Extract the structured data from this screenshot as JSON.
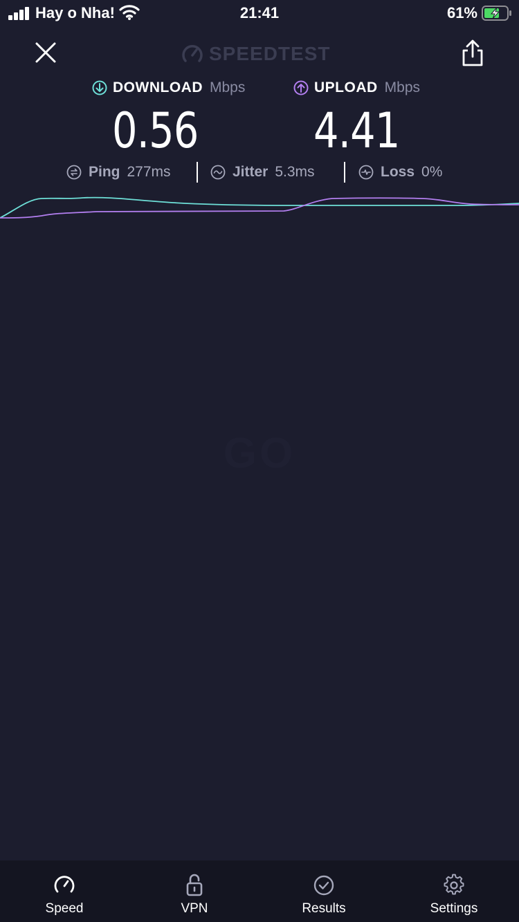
{
  "status_bar": {
    "carrier": "Hay o Nha!",
    "time": "21:41",
    "battery": "61%"
  },
  "header": {
    "brand": "SPEEDTEST"
  },
  "download": {
    "label": "DOWNLOAD",
    "unit": "Mbps",
    "value": "0.56"
  },
  "upload": {
    "label": "UPLOAD",
    "unit": "Mbps",
    "value": "4.41"
  },
  "metrics": {
    "ping": {
      "label": "Ping",
      "value": "277ms"
    },
    "jitter": {
      "label": "Jitter",
      "value": "5.3ms"
    },
    "loss": {
      "label": "Loss",
      "value": "0%"
    }
  },
  "go_label": "GO",
  "tabs": [
    {
      "label": "Speed",
      "icon": "speedometer-icon"
    },
    {
      "label": "VPN",
      "icon": "unlock-icon"
    },
    {
      "label": "Results",
      "icon": "checkmark-circle-icon"
    },
    {
      "label": "Settings",
      "icon": "gear-icon"
    }
  ],
  "colors": {
    "download": "#6ee0d8",
    "upload": "#b37ff0",
    "background": "#1c1d2e"
  }
}
